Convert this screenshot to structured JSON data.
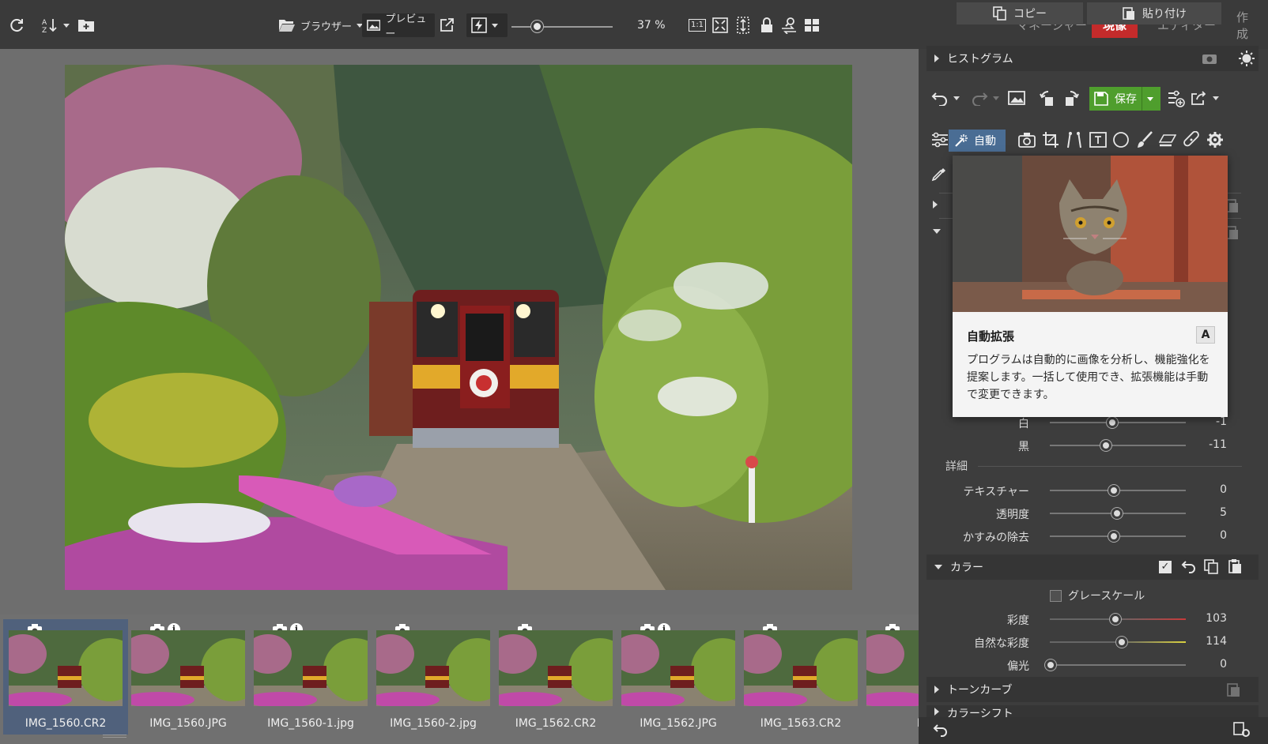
{
  "toolbar": {
    "browser_label": "ブラウザー",
    "preview_label": "プレビュー",
    "zoom_value": "37 %",
    "zoom_level": 0.25,
    "one_to_one_label": "1:1"
  },
  "modes": {
    "manager": "マネージャー",
    "develop": "現像",
    "editor": "エディター",
    "create": "作成"
  },
  "panel": {
    "histogram_label": "ヒストグラム",
    "save_label": "保存",
    "auto_label": "自動",
    "tooltip": {
      "title": "自動拡張",
      "shortcut": "A",
      "body": "プログラムは自動的に画像を分析し、機能強化を提案します。一括して使用でき、拡張機能は手動で変更できます。"
    },
    "tone_sliders": [
      {
        "label": "白",
        "value": "-1",
        "pos": 0.49
      },
      {
        "label": "黒",
        "value": "-11",
        "pos": 0.44
      }
    ],
    "detail_header": "詳細",
    "detail_sliders": [
      {
        "label": "テキスチャー",
        "value": "0",
        "pos": 0.5
      },
      {
        "label": "透明度",
        "value": "5",
        "pos": 0.52
      },
      {
        "label": "かすみの除去",
        "value": "0",
        "pos": 0.5
      }
    ],
    "color_section": "カラー",
    "grayscale_label": "グレースケール",
    "color_sliders": [
      {
        "label": "彩度",
        "value": "103",
        "pos": 0.51
      },
      {
        "label": "自然な彩度",
        "value": "114",
        "pos": 0.55
      },
      {
        "label": "偏光",
        "value": "0",
        "pos": 0.02
      }
    ],
    "tone_curve_section": "トーンカーブ",
    "color_shift_section": "カラーシフト",
    "copy_label": "コピー",
    "paste_label": "貼り付け"
  },
  "filmstrip": [
    {
      "name": "IMG_1560.CR2",
      "info": false,
      "selected": true
    },
    {
      "name": "IMG_1560.JPG",
      "info": true,
      "selected": false
    },
    {
      "name": "IMG_1560-1.jpg",
      "info": true,
      "selected": false
    },
    {
      "name": "IMG_1560-2.jpg",
      "info": false,
      "selected": false
    },
    {
      "name": "IMG_1562.CR2",
      "info": false,
      "selected": false
    },
    {
      "name": "IMG_1562.JPG",
      "info": true,
      "selected": false
    },
    {
      "name": "IMG_1563.CR2",
      "info": false,
      "selected": false
    },
    {
      "name": "IM",
      "info": false,
      "selected": false
    }
  ],
  "colors": {
    "accent_develop": "#c42b2b",
    "save_green": "#4f9e2d",
    "auto_blue": "#4a6d94"
  }
}
